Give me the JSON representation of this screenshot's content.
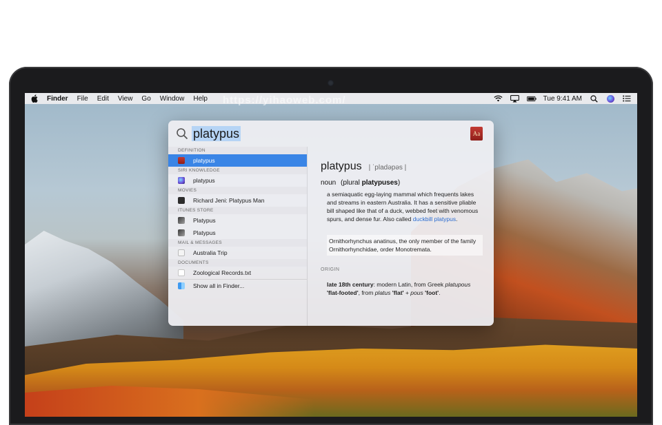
{
  "menubar": {
    "app_name": "Finder",
    "menus": [
      "File",
      "Edit",
      "View",
      "Go",
      "Window",
      "Help"
    ],
    "clock": "Tue 9:41 AM",
    "status_icons": [
      "wifi-icon",
      "airplay-icon",
      "battery-icon",
      "search-icon",
      "siri-icon",
      "list-icon"
    ]
  },
  "spotlight": {
    "query": "platypus",
    "sections": [
      {
        "header": "DEFINITION",
        "items": [
          {
            "label": "platypus",
            "icon": "dictionary-icon",
            "selected": true
          }
        ]
      },
      {
        "header": "SIRI KNOWLEDGE",
        "items": [
          {
            "label": "platypus",
            "icon": "siri-icon"
          }
        ]
      },
      {
        "header": "MOVIES",
        "items": [
          {
            "label": "Richard Jeni: Platypus Man",
            "icon": "movie-icon"
          }
        ]
      },
      {
        "header": "ITUNES STORE",
        "items": [
          {
            "label": "Platypus",
            "icon": "itunes-icon"
          },
          {
            "label": "Platypus",
            "icon": "itunes-icon"
          }
        ]
      },
      {
        "header": "MAIL & MESSAGES",
        "items": [
          {
            "label": "Australia Trip",
            "icon": "mail-icon"
          }
        ]
      },
      {
        "header": "DOCUMENTS",
        "items": [
          {
            "label": "Zoological Records.txt",
            "icon": "document-icon"
          }
        ]
      }
    ],
    "show_all": "Show all in Finder..."
  },
  "preview": {
    "word": "platypus",
    "pronunciation": "| ˈpladəpəs |",
    "pos_label": "noun",
    "plural_open": "(plural",
    "plural": "platypuses",
    "plural_close": ")",
    "definition_1": "a semiaquatic egg-laying mammal which frequents lakes and streams in eastern Australia. It has a sensitive pliable bill shaped like that of a duck, webbed feet with venomous spurs, and dense fur. Also called",
    "definition_link": "duckbill platypus",
    "definition_end": ".",
    "zoology": "Ornithorhynchus anatinus, the only member of the family Ornithorhynchidae, order Monotremata.",
    "origin_header": "ORIGIN",
    "origin_a": "late 18th century",
    "origin_b": ": modern Latin, from Greek",
    "origin_c": "platupous",
    "origin_d": "'flat-footed'",
    "origin_e": ", from",
    "origin_f": "platus",
    "origin_g": "'flat'",
    "origin_h": "+",
    "origin_i": "pous",
    "origin_j": "'foot'",
    "origin_k": "."
  },
  "watermark": "https://yihaoweb.com/"
}
